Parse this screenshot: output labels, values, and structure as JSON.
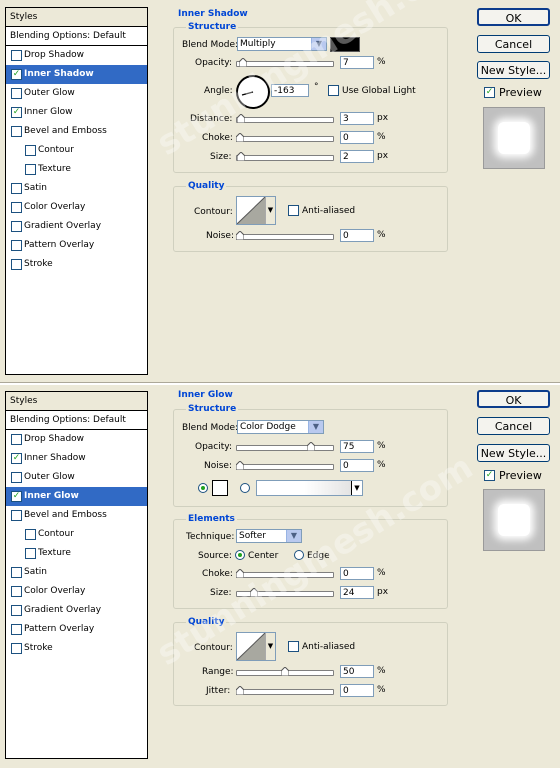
{
  "watermark": "stunningmesh.com",
  "common": {
    "styles_header": "Styles",
    "blending_options": "Blending Options: Default",
    "ok": "OK",
    "cancel": "Cancel",
    "new_style": "New Style...",
    "preview": "Preview",
    "blend_mode_label": "Blend Mode:",
    "opacity_label": "Opacity:",
    "noise_label": "Noise:",
    "choke_label": "Choke:",
    "size_label": "Size:",
    "contour_label": "Contour:",
    "anti_aliased": "Anti-aliased",
    "structure": "Structure",
    "quality": "Quality",
    "pct": "%",
    "px": "px"
  },
  "panel1": {
    "section_title": "Inner Shadow",
    "style_items": [
      {
        "label": "Drop Shadow",
        "checked": false,
        "selected": false,
        "sub": false
      },
      {
        "label": "Inner Shadow",
        "checked": true,
        "selected": true,
        "sub": false
      },
      {
        "label": "Outer Glow",
        "checked": false,
        "selected": false,
        "sub": false
      },
      {
        "label": "Inner Glow",
        "checked": true,
        "selected": false,
        "sub": false
      },
      {
        "label": "Bevel and Emboss",
        "checked": false,
        "selected": false,
        "sub": false
      },
      {
        "label": "Contour",
        "checked": false,
        "selected": false,
        "sub": true
      },
      {
        "label": "Texture",
        "checked": false,
        "selected": false,
        "sub": true
      },
      {
        "label": "Satin",
        "checked": false,
        "selected": false,
        "sub": false
      },
      {
        "label": "Color Overlay",
        "checked": false,
        "selected": false,
        "sub": false
      },
      {
        "label": "Gradient Overlay",
        "checked": false,
        "selected": false,
        "sub": false
      },
      {
        "label": "Pattern Overlay",
        "checked": false,
        "selected": false,
        "sub": false
      },
      {
        "label": "Stroke",
        "checked": false,
        "selected": false,
        "sub": false
      }
    ],
    "blend_mode": "Multiply",
    "shadow_color": "#000000",
    "opacity": "7",
    "angle_label": "Angle:",
    "angle": "-163",
    "degree": "°",
    "use_global_light": "Use Global Light",
    "distance_label": "Distance:",
    "distance": "3",
    "choke": "0",
    "size": "2",
    "noise": "0"
  },
  "panel2": {
    "section_title": "Inner Glow",
    "style_items": [
      {
        "label": "Drop Shadow",
        "checked": false,
        "selected": false,
        "sub": false
      },
      {
        "label": "Inner Shadow",
        "checked": true,
        "selected": false,
        "sub": false
      },
      {
        "label": "Outer Glow",
        "checked": false,
        "selected": false,
        "sub": false
      },
      {
        "label": "Inner Glow",
        "checked": true,
        "selected": true,
        "sub": false
      },
      {
        "label": "Bevel and Emboss",
        "checked": false,
        "selected": false,
        "sub": false
      },
      {
        "label": "Contour",
        "checked": false,
        "selected": false,
        "sub": true
      },
      {
        "label": "Texture",
        "checked": false,
        "selected": false,
        "sub": true
      },
      {
        "label": "Satin",
        "checked": false,
        "selected": false,
        "sub": false
      },
      {
        "label": "Color Overlay",
        "checked": false,
        "selected": false,
        "sub": false
      },
      {
        "label": "Gradient Overlay",
        "checked": false,
        "selected": false,
        "sub": false
      },
      {
        "label": "Pattern Overlay",
        "checked": false,
        "selected": false,
        "sub": false
      },
      {
        "label": "Stroke",
        "checked": false,
        "selected": false,
        "sub": false
      }
    ],
    "blend_mode": "Color Dodge",
    "opacity": "75",
    "noise": "0",
    "elements": "Elements",
    "technique_label": "Technique:",
    "technique": "Softer",
    "source_label": "Source:",
    "source_center": "Center",
    "source_edge": "Edge",
    "choke": "0",
    "size": "24",
    "range_label": "Range:",
    "range": "50",
    "jitter_label": "Jitter:",
    "jitter": "0"
  }
}
